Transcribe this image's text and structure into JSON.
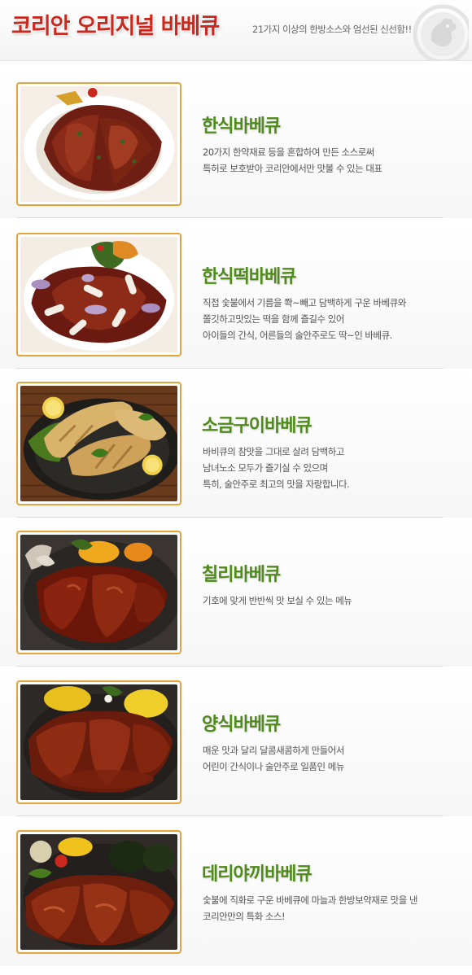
{
  "header": {
    "title": "코리안 오리지널 바베큐",
    "tagline": "21가지 이상의 한방소스와 엄선된 신선함!!",
    "logo_icon": "rooster-icon"
  },
  "colors": {
    "title_red": "#c8281e",
    "name_green": "#4f8a1a",
    "frame_orange": "#e6a33a"
  },
  "menu": [
    {
      "name": "한식바베큐",
      "lines": [
        "20가지 한약재료 등을 혼합하여 만든 소스로써",
        "특허로 보호받아 코리안에서만 맛볼 수 있는 대표"
      ]
    },
    {
      "name": "한식떡바베큐",
      "lines": [
        "직접 숯불에서 기름을 쫙~빼고 담백하게 구운 바베큐와",
        "쫄깃하고맛있는 떡을 함께 즐길수 있어",
        "아이들의 간식, 어른들의 술안주로도 딱~인 바베큐."
      ]
    },
    {
      "name": "소금구이바베큐",
      "lines": [
        "바비큐의 참맛을 그대로 살려 담백하고",
        "남녀노소 모두가 즐기실 수 있으며",
        "특히, 술안주로 최고의 맛을 자랑합니다."
      ]
    },
    {
      "name": "칠리바베큐",
      "lines": [
        "기호에 맞게 반반씩 맛 보실 수 있는 메뉴"
      ]
    },
    {
      "name": "양식바베큐",
      "lines": [
        "매운 맛과 달리 달콤새콤하게 만들어서",
        "어린이 간식이나 술안주로 일품인 메뉴"
      ]
    },
    {
      "name": "데리야끼바베큐",
      "lines": [
        "숯불에 직화로 구운 바베큐에 마늘과 한방보약재로 맛을 낸",
        "코리안만의 특화 소스!"
      ]
    }
  ]
}
